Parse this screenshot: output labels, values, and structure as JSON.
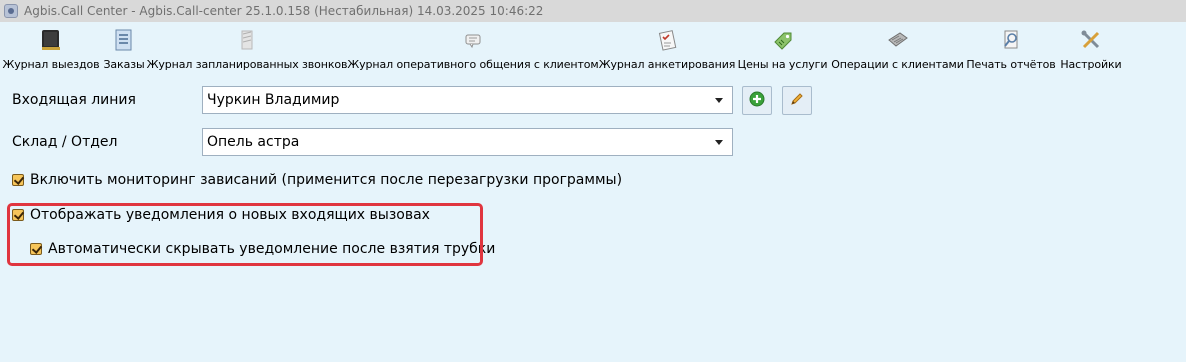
{
  "window": {
    "title": "Agbis.Call Center - Agbis.Call-center 25.1.0.158 (Нестабильная) 14.03.2025 10:46:22"
  },
  "toolbar": {
    "items": [
      {
        "label": "Журнал выездов",
        "icon": "journal-book-icon"
      },
      {
        "label": "Заказы",
        "icon": "orders-document-icon"
      },
      {
        "label": "Журнал запланированных звонков",
        "icon": "scheduled-calls-icon"
      },
      {
        "label": "Журнал оперативного общения с клиентом",
        "icon": "chat-bubble-icon"
      },
      {
        "label": "Журнал анкетирования",
        "icon": "survey-checklist-icon"
      },
      {
        "label": "Цены на услуги",
        "icon": "price-tag-icon"
      },
      {
        "label": "Операции с клиентами",
        "icon": "cash-register-icon"
      },
      {
        "label": "Печать отчётов",
        "icon": "print-report-icon"
      },
      {
        "label": "Настройки",
        "icon": "wrench-screwdriver-icon"
      }
    ]
  },
  "form": {
    "incoming_line": {
      "label": "Входящая линия",
      "value": "Чуркин Владимир"
    },
    "warehouse": {
      "label": "Склад / Отдел",
      "value": "Опель астра"
    },
    "checkboxes": [
      {
        "label": "Включить мониторинг зависаний (применится после перезагрузки программы)",
        "checked": true
      },
      {
        "label": "Отображать уведомления о новых входящих вызовах",
        "checked": true
      },
      {
        "label": "Автоматически скрывать уведомление после взятия трубки",
        "checked": true
      }
    ]
  },
  "colors": {
    "background": "#e6f4fb",
    "highlight": "#e0353f",
    "checkbox": "#f6c55a"
  }
}
